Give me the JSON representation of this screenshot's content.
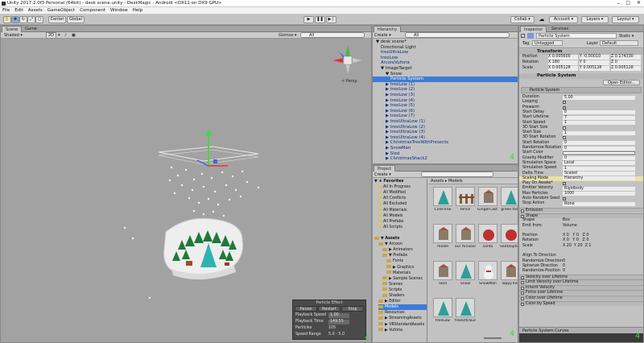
{
  "window_title": "Unity 2017.2.0f3 Personal (64bit) - desk scene.unity - DeskMagic - Android <DX11 on DX9 GPU>",
  "menu": [
    "File",
    "Edit",
    "Assets",
    "GameObject",
    "Component",
    "Window",
    "Help"
  ],
  "toolbar": {
    "center": "Center",
    "global": "Global",
    "collab": "Collab ▾",
    "account": "Account",
    "layers": "Layers",
    "layout": "Layout",
    "cloud_icon": "cloud-icon"
  },
  "scene": {
    "tabs": [
      "Scene",
      "Game"
    ],
    "shaded": "Shaded",
    "mode2d": "2D",
    "gizmos": "Gizmos",
    "search": "All",
    "persp": "< Persp",
    "effect": {
      "title": "Particle Effect",
      "buttons": [
        "Pause",
        "Restart",
        "Stop"
      ],
      "rows": [
        [
          "Playback Speed",
          "1.00"
        ],
        [
          "Playback Time",
          "149.55"
        ],
        [
          "Particles",
          "105"
        ],
        [
          "Speed Range",
          "5.0 - 5.0"
        ]
      ]
    },
    "counter": "4"
  },
  "hierarchy": {
    "tab": "Hierarchy",
    "create": "Create ▾",
    "search": "All",
    "rows": [
      {
        "t": "▼ desk scene*",
        "lv": 0,
        "c": "blk"
      },
      {
        "t": "Directional Light",
        "lv": 1,
        "c": "blk"
      },
      {
        "t": "treeUltraLow",
        "lv": 1,
        "c": "blu"
      },
      {
        "t": "treeLow",
        "lv": 1,
        "c": "blu"
      },
      {
        "t": "ArcoreVuforia",
        "lv": 1,
        "c": "blu"
      },
      {
        "t": "▼ ImageTarget",
        "lv": 1,
        "c": "blk"
      },
      {
        "t": "▼ Snow",
        "lv": 2,
        "c": "blk"
      },
      {
        "t": "Particle System",
        "lv": 3,
        "c": "sel"
      },
      {
        "t": "▶ treeLow (1)",
        "lv": 2,
        "c": "blu"
      },
      {
        "t": "▶ treeLow (2)",
        "lv": 2,
        "c": "blu"
      },
      {
        "t": "▶ treeLow (3)",
        "lv": 2,
        "c": "blu"
      },
      {
        "t": "▶ treeLow (4)",
        "lv": 2,
        "c": "blu"
      },
      {
        "t": "▶ treeLow (5)",
        "lv": 2,
        "c": "blu"
      },
      {
        "t": "▶ treeLow (6)",
        "lv": 2,
        "c": "blu"
      },
      {
        "t": "▶ treeLow (7)",
        "lv": 2,
        "c": "blu"
      },
      {
        "t": "▶ treeUltraLow (1)",
        "lv": 2,
        "c": "blu"
      },
      {
        "t": "▶ treeUltraLow (2)",
        "lv": 2,
        "c": "blu"
      },
      {
        "t": "▶ treeUltraLow (3)",
        "lv": 2,
        "c": "blu"
      },
      {
        "t": "▶ treeUltraLow (4)",
        "lv": 2,
        "c": "blu"
      },
      {
        "t": "▶ ChristmasTreeWithPresents",
        "lv": 2,
        "c": "blu"
      },
      {
        "t": "▶ SnowMan",
        "lv": 2,
        "c": "blu"
      },
      {
        "t": "▶ Sled",
        "lv": 2,
        "c": "blu"
      },
      {
        "t": "▶ ChristmasShack2",
        "lv": 2,
        "c": "blu"
      }
    ],
    "counter": "4"
  },
  "project": {
    "tab": "Project",
    "create": "Create ▾",
    "breadcrumb": "Assets ▸ Models",
    "tree": [
      {
        "t": "▼ ★ Favorites",
        "lv": 0,
        "b": true
      },
      {
        "t": "All In Progress",
        "lv": 1,
        "s": true
      },
      {
        "t": "All Modified",
        "lv": 1,
        "s": true
      },
      {
        "t": "All Conflicts",
        "lv": 1,
        "s": true
      },
      {
        "t": "All Excluded",
        "lv": 1,
        "s": true
      },
      {
        "t": "All Materials",
        "lv": 1,
        "s": true
      },
      {
        "t": "All Models",
        "lv": 1,
        "s": true
      },
      {
        "t": "All Prefabs",
        "lv": 1,
        "s": true
      },
      {
        "t": "All Scripts",
        "lv": 1,
        "s": true
      },
      {
        "t": "",
        "lv": 0
      },
      {
        "t": "▼ Assets",
        "lv": 0,
        "b": true,
        "f": true
      },
      {
        "t": "▼ Arcoon",
        "lv": 1,
        "f": true
      },
      {
        "t": "▶ Animators",
        "lv": 2,
        "f": true
      },
      {
        "t": "▼ Prefabs",
        "lv": 2,
        "f": true
      },
      {
        "t": "Fonts",
        "lv": 3,
        "f": true
      },
      {
        "t": "▶ Graphics",
        "lv": 3,
        "f": true
      },
      {
        "t": "Materials",
        "lv": 3,
        "f": true
      },
      {
        "t": "▶ Sample Scenes",
        "lv": 2,
        "f": true
      },
      {
        "t": "Scenes",
        "lv": 2,
        "f": true
      },
      {
        "t": "Scripts",
        "lv": 2,
        "f": true
      },
      {
        "t": "Shaders",
        "lv": 2,
        "f": true
      },
      {
        "t": "▶ Editor",
        "lv": 1,
        "f": true
      },
      {
        "t": "Models",
        "lv": 1,
        "f": true,
        "sel": true
      },
      {
        "t": "Resources",
        "lv": 1,
        "f": true
      },
      {
        "t": "▶ StreamingAssets",
        "lv": 1,
        "f": true
      },
      {
        "t": "▶ VRStandardAssets",
        "lv": 1,
        "f": true
      },
      {
        "t": "▶ Vuforia",
        "lv": 1,
        "f": true
      }
    ],
    "assets": [
      "ConeTree",
      "fence",
      "GingerCast...",
      "green tree",
      "model",
      "our Arcoour",
      "santa",
      "SantaSphere",
      "Sled",
      "Snow",
      "SnowMan",
      "TappyTree",
      "treeLow",
      "treeUltraLow"
    ],
    "counter": "4"
  },
  "inspector": {
    "tabs": [
      "Inspector",
      "Services"
    ],
    "object_name": "Particle System",
    "static": "Static ▾",
    "tag_label": "Tag",
    "tag": "Untagged",
    "layer_label": "Layer",
    "layer": "Default",
    "transform": "Transform",
    "tf_rows": [
      [
        "Position",
        "X 0.005600",
        "Y -0.00010",
        "Z 0.174330"
      ],
      [
        "Rotation",
        "X 180",
        "Y 0",
        "Z 0"
      ],
      [
        "Scale",
        "X 0.005128",
        "Y 0.005128",
        "Z 0.005128"
      ]
    ],
    "ps_header": "Particle System",
    "open_editor": "Open Editor...",
    "ps_sub": "Particle System",
    "props": [
      [
        "Duration",
        "5.00"
      ],
      [
        "Looping",
        "✓"
      ],
      [
        "Prewarm",
        "✓"
      ],
      [
        "Start Delay",
        "0"
      ],
      [
        "Start Lifetime",
        "7"
      ],
      [
        "Start Speed",
        "1"
      ],
      [
        "3D Start Size",
        ""
      ],
      [
        "Start Size",
        "1"
      ],
      [
        "3D Start Rotation",
        ""
      ],
      [
        "Start Rotation",
        "0"
      ],
      [
        "Randomize Rotation",
        "0"
      ],
      [
        "Start Color",
        ""
      ],
      [
        "Gravity Modifier",
        "0"
      ],
      [
        "Simulation Space",
        "Local"
      ],
      [
        "Simulation Speed",
        "1"
      ],
      [
        "Delta Time",
        "Scaled"
      ],
      [
        "Scaling Mode",
        "Hierarchy"
      ],
      [
        "Play On Awake*",
        "✓"
      ],
      [
        "Emitter Velocity",
        "Rigidbody"
      ],
      [
        "Max Particles",
        "1000"
      ],
      [
        "Auto Random Seed",
        "✓"
      ],
      [
        "Stop Action",
        "None"
      ]
    ],
    "emission": "Emission",
    "shape": "Shape",
    "shape_rows": [
      [
        "Shape",
        "Box"
      ],
      [
        "Emit from:",
        "Volume"
      ],
      [
        "",
        ""
      ],
      [
        "Position",
        "X 0   Y 0   Z 0"
      ],
      [
        "Rotation",
        "X 0   Y 0   Z 0"
      ],
      [
        "Scale",
        "X 20  Y 20  Z 1"
      ],
      [
        "",
        ""
      ],
      [
        "Align To Direction",
        ""
      ],
      [
        "Randomize Direction",
        "0"
      ],
      [
        "Spherize Direction",
        "0"
      ],
      [
        "Randomize Position",
        "0"
      ]
    ],
    "modules": [
      "Velocity over Lifetime",
      "Limit Velocity over Lifetime",
      "Inherit Velocity",
      "Force over Lifetime",
      "Color over Lifetime",
      "Color by Speed"
    ],
    "curves": "Particle System Curves",
    "counter": "4"
  },
  "colors": {
    "selection": "#3d7bd6",
    "panel": "#c2c2c2",
    "scene_bg": "#a2a2a2",
    "counter": "#3fd64a"
  }
}
